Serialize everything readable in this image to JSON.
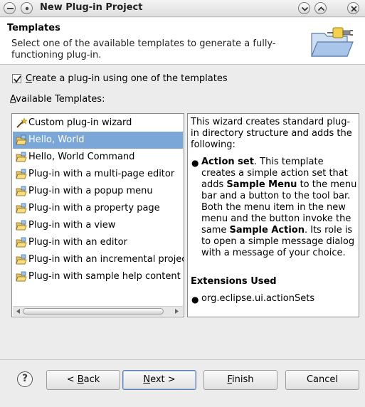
{
  "window": {
    "title": "New Plug-in Project"
  },
  "banner": {
    "title": "Templates",
    "description": "Select one of the available templates to generate a fully-functioning plug-in."
  },
  "options": {
    "use_template_label": "Create a plug-in using one of the templates",
    "use_template_checked": true,
    "available_templates_label": "Available Templates:"
  },
  "templates": [
    {
      "label": "Custom plug-in wizard",
      "icon": "wand-icon",
      "selected": false
    },
    {
      "label": "Hello, World",
      "icon": "folder-icon",
      "selected": true
    },
    {
      "label": "Hello, World Command",
      "icon": "folder-icon",
      "selected": false
    },
    {
      "label": "Plug-in with a multi-page editor",
      "icon": "folder-icon",
      "selected": false
    },
    {
      "label": "Plug-in with a popup menu",
      "icon": "folder-icon",
      "selected": false
    },
    {
      "label": "Plug-in with a property page",
      "icon": "folder-icon",
      "selected": false
    },
    {
      "label": "Plug-in with a view",
      "icon": "folder-icon",
      "selected": false
    },
    {
      "label": "Plug-in with an editor",
      "icon": "folder-icon",
      "selected": false
    },
    {
      "label": "Plug-in with an incremental project",
      "icon": "folder-icon",
      "selected": false
    },
    {
      "label": "Plug-in with sample help content",
      "icon": "folder-icon",
      "selected": false
    }
  ],
  "description": {
    "intro": "This wizard creates standard plug-in directory structure and adds the following:",
    "bullet_title": "Action set",
    "bullet_text_1": ". This template creates a simple action set that adds ",
    "bullet_bold_1": "Sample Menu",
    "bullet_text_2": " to the menu bar and a button to the tool bar. Both the menu item in the new menu and the button invoke the same ",
    "bullet_bold_2": "Sample Action",
    "bullet_text_3": ". Its role is to open a simple message dialog with a message of your choice.",
    "extensions_title": "Extensions Used",
    "extension_item": "org.eclipse.ui.actionSets"
  },
  "buttons": {
    "help": "?",
    "back_prefix": "< ",
    "back_mnemonic": "B",
    "back_rest": "ack",
    "next_mnemonic": "N",
    "next_rest": "ext >",
    "finish_mnemonic": "F",
    "finish_rest": "inish",
    "cancel": "Cancel"
  },
  "colors": {
    "selection": "#7aa6d8",
    "dialog_bg": "#ececec"
  }
}
